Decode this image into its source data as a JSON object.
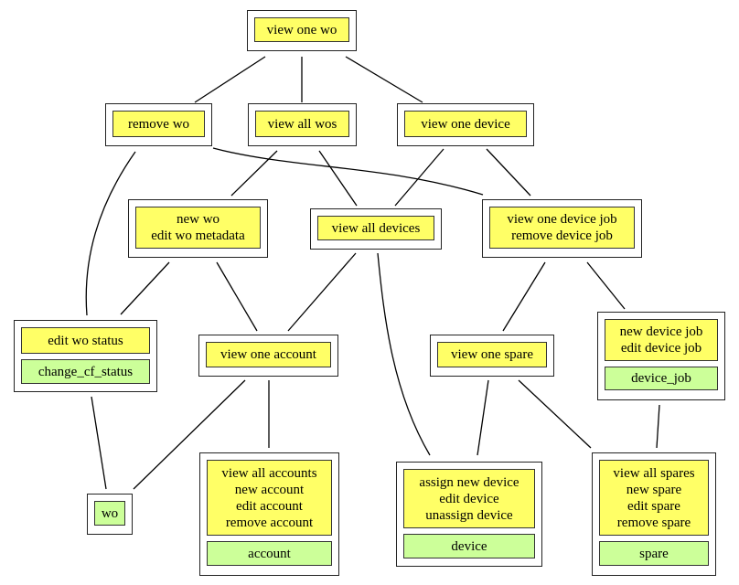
{
  "colors": {
    "action": "#ffff66",
    "entity": "#ccff99",
    "border": "#222222"
  },
  "nodes": {
    "view_one_wo": {
      "actions": [
        "view one wo"
      ]
    },
    "remove_wo": {
      "actions": [
        "remove wo"
      ]
    },
    "view_all_wos": {
      "actions": [
        "view all wos"
      ]
    },
    "view_one_device": {
      "actions": [
        "view one device"
      ]
    },
    "new_wo": {
      "actions": [
        "new wo",
        "edit wo metadata"
      ]
    },
    "view_all_devices": {
      "actions": [
        "view all devices"
      ]
    },
    "view_one_device_job": {
      "actions": [
        "view one device job",
        "remove device job"
      ]
    },
    "edit_wo_status": {
      "actions": [
        "edit wo status"
      ],
      "entity": "change_cf_status"
    },
    "view_one_account": {
      "actions": [
        "view one account"
      ]
    },
    "view_one_spare": {
      "actions": [
        "view one spare"
      ]
    },
    "device_job": {
      "actions": [
        "new device job",
        "edit device job"
      ],
      "entity": "device_job"
    },
    "wo": {
      "entity": "wo"
    },
    "account": {
      "actions": [
        "view all accounts",
        "new account",
        "edit account",
        "remove account"
      ],
      "entity": "account"
    },
    "device": {
      "actions": [
        "assign new device",
        "edit device",
        "unassign device"
      ],
      "entity": "device"
    },
    "spare": {
      "actions": [
        "view all spares",
        "new spare",
        "edit spare",
        "remove spare"
      ],
      "entity": "spare"
    }
  },
  "edges": [
    [
      "view_one_wo",
      "remove_wo"
    ],
    [
      "view_one_wo",
      "view_all_wos"
    ],
    [
      "view_one_wo",
      "view_one_device"
    ],
    [
      "remove_wo",
      "edit_wo_status"
    ],
    [
      "remove_wo",
      "view_one_device_job"
    ],
    [
      "view_all_wos",
      "new_wo"
    ],
    [
      "view_all_wos",
      "view_all_devices"
    ],
    [
      "view_one_device",
      "view_all_devices"
    ],
    [
      "view_one_device",
      "view_one_device_job"
    ],
    [
      "new_wo",
      "edit_wo_status"
    ],
    [
      "new_wo",
      "view_one_account"
    ],
    [
      "view_all_devices",
      "view_one_account"
    ],
    [
      "view_all_devices",
      "device"
    ],
    [
      "view_one_device_job",
      "view_one_spare"
    ],
    [
      "view_one_device_job",
      "device_job"
    ],
    [
      "edit_wo_status",
      "wo"
    ],
    [
      "view_one_account",
      "wo"
    ],
    [
      "view_one_account",
      "account"
    ],
    [
      "view_one_spare",
      "device"
    ],
    [
      "view_one_spare",
      "spare"
    ],
    [
      "device_job",
      "spare"
    ]
  ]
}
